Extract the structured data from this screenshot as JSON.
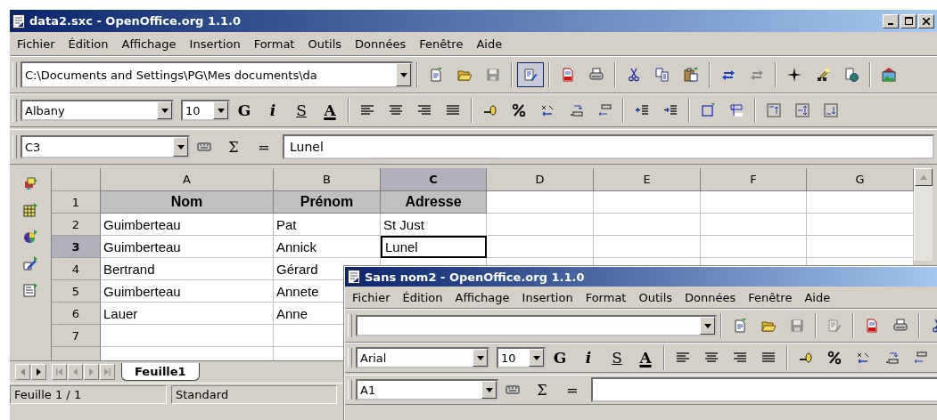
{
  "window": {
    "title": "data2.sxc - OpenOffice.org 1.1.0"
  },
  "menu": [
    "Fichier",
    "Édition",
    "Affichage",
    "Insertion",
    "Format",
    "Outils",
    "Données",
    "Fenêtre",
    "Aide"
  ],
  "function_bar": {
    "path": "C:\\Documents and Settings\\PG\\Mes documents\\da",
    "buttons": {
      "save": {
        "disabled": true
      },
      "edit": {
        "pressed": true,
        "disabled": false
      },
      "redo": {
        "disabled": true
      }
    }
  },
  "object_bar": {
    "font": "Albany",
    "size": "10",
    "bold": "G",
    "italic": "i",
    "underline": "S",
    "font_color": "A"
  },
  "formula_bar": {
    "cell": "C3",
    "sum": "Σ",
    "equals": "=",
    "value": "Lunel"
  },
  "sheet": {
    "columns": [
      {
        "label": "A",
        "selected": false
      },
      {
        "label": "B",
        "selected": false
      },
      {
        "label": "C",
        "selected": true
      },
      {
        "label": "D",
        "selected": false
      },
      {
        "label": "E",
        "selected": false
      },
      {
        "label": "F",
        "selected": false
      },
      {
        "label": "G",
        "selected": false
      }
    ],
    "rows": [
      {
        "number": "1",
        "selected": false,
        "cells": [
          {
            "text": "Nom",
            "kind": "heading",
            "selected": false
          },
          {
            "text": "Prénom",
            "kind": "heading",
            "selected": false
          },
          {
            "text": "Adresse",
            "kind": "heading",
            "selected": false
          }
        ]
      },
      {
        "number": "2",
        "selected": false,
        "cells": [
          {
            "text": "Guimberteau",
            "kind": "text",
            "selected": false
          },
          {
            "text": "Pat",
            "kind": "text",
            "selected": false
          },
          {
            "text": "St Just",
            "kind": "text",
            "selected": false
          }
        ]
      },
      {
        "number": "3",
        "selected": true,
        "cells": [
          {
            "text": "Guimberteau",
            "kind": "text",
            "selected": false
          },
          {
            "text": "Annick",
            "kind": "text",
            "selected": false
          },
          {
            "text": "Lunel",
            "kind": "text",
            "selected": true
          }
        ]
      },
      {
        "number": "4",
        "selected": false,
        "cells": [
          {
            "text": "Bertrand",
            "kind": "text",
            "selected": false
          },
          {
            "text": "Gérard",
            "kind": "text",
            "selected": false
          }
        ]
      },
      {
        "number": "5",
        "selected": false,
        "cells": [
          {
            "text": "Guimberteau",
            "kind": "text",
            "selected": false
          },
          {
            "text": "Annete",
            "kind": "text",
            "selected": false
          }
        ]
      },
      {
        "number": "6",
        "selected": false,
        "cells": [
          {
            "text": "Lauer",
            "kind": "text",
            "selected": false
          },
          {
            "text": "Anne",
            "kind": "text",
            "selected": false
          }
        ]
      },
      {
        "number": "7",
        "selected": false
      },
      {
        "selected": false
      }
    ]
  },
  "sheet_tabs": [
    {
      "label": "Feuille1",
      "selected": true
    }
  ],
  "status_bar": [
    "Feuille 1 / 1",
    "Standard"
  ],
  "second_window": {
    "title": "Sans nom2 - OpenOffice.org 1.1.0",
    "menu": [
      "Fichier",
      "Édition",
      "Affichage",
      "Insertion",
      "Format",
      "Outils",
      "Données",
      "Fenêtre",
      "Aide"
    ],
    "buttons": {
      "save": {
        "disabled": true
      },
      "edit": {
        "pressed": false,
        "disabled": true
      }
    },
    "font": "Arial",
    "size": "10",
    "bold": "G",
    "italic": "i",
    "underline": "S",
    "font_color": "A",
    "cell": "A1",
    "sum": "Σ",
    "equals": "="
  }
}
